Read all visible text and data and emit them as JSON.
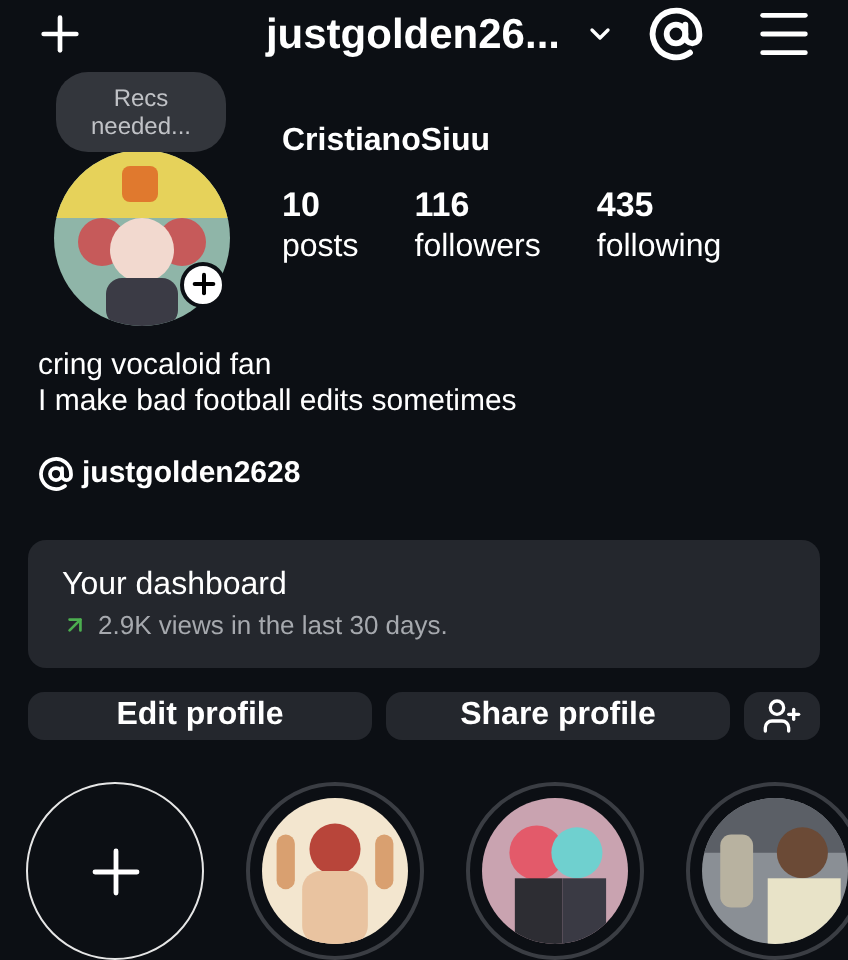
{
  "header": {
    "username": "justgolden26..."
  },
  "note": {
    "text": "Recs needed..."
  },
  "profile": {
    "display_name": "CristianoSiuu",
    "stats": [
      {
        "value": "10",
        "label": "posts"
      },
      {
        "value": "116",
        "label": "followers"
      },
      {
        "value": "435",
        "label": "following"
      }
    ]
  },
  "bio": [
    "cring vocaloid fan",
    "I make bad football edits sometimes"
  ],
  "threads_link": "justgolden2628",
  "dashboard": {
    "title": "Your dashboard",
    "subtitle": "2.9K views in the last 30 days."
  },
  "buttons": [
    "Edit profile",
    "Share profile"
  ],
  "highlights": [
    {
      "kind": "new"
    },
    {
      "kind": "picture",
      "color": "#f3e6cf"
    },
    {
      "kind": "picture",
      "color": "#c9a3b0"
    },
    {
      "kind": "picture",
      "color": "#8a8f95"
    }
  ]
}
